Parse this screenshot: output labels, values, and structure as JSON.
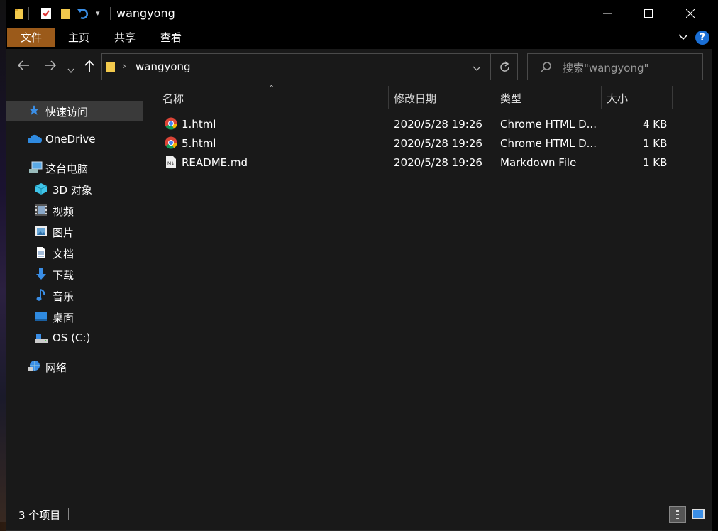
{
  "window": {
    "title": "wangyong"
  },
  "ribbon": {
    "tabs": [
      "文件",
      "主页",
      "共享",
      "查看"
    ],
    "help": "?"
  },
  "nav": {
    "path_segment": "wangyong",
    "search_placeholder": "搜索\"wangyong\""
  },
  "sidebar": {
    "items": [
      {
        "label": "快速访问",
        "icon": "star-icon"
      },
      {
        "label": "OneDrive",
        "icon": "cloud-icon"
      },
      {
        "label": "这台电脑",
        "icon": "computer-icon"
      },
      {
        "label": "3D 对象",
        "icon": "cube-icon"
      },
      {
        "label": "视频",
        "icon": "video-icon"
      },
      {
        "label": "图片",
        "icon": "picture-icon"
      },
      {
        "label": "文档",
        "icon": "document-icon"
      },
      {
        "label": "下载",
        "icon": "download-icon"
      },
      {
        "label": "音乐",
        "icon": "music-icon"
      },
      {
        "label": "桌面",
        "icon": "desktop-icon"
      },
      {
        "label": "OS (C:)",
        "icon": "drive-icon"
      },
      {
        "label": "网络",
        "icon": "network-icon"
      }
    ]
  },
  "columns": [
    "名称",
    "修改日期",
    "类型",
    "大小"
  ],
  "files": [
    {
      "name": "1.html",
      "date": "2020/5/28 19:26",
      "type": "Chrome HTML D...",
      "size": "4 KB",
      "icon": "chrome-icon"
    },
    {
      "name": "5.html",
      "date": "2020/5/28 19:26",
      "type": "Chrome HTML D...",
      "size": "1 KB",
      "icon": "chrome-icon"
    },
    {
      "name": "README.md",
      "date": "2020/5/28 19:26",
      "type": "Markdown File",
      "size": "1 KB",
      "icon": "markdown-icon"
    }
  ],
  "status": {
    "count": "3 个项目"
  },
  "colors": {
    "accent_file_tab": "#9b5a1a",
    "selection": "#3a3a3a",
    "background": "#191919"
  }
}
